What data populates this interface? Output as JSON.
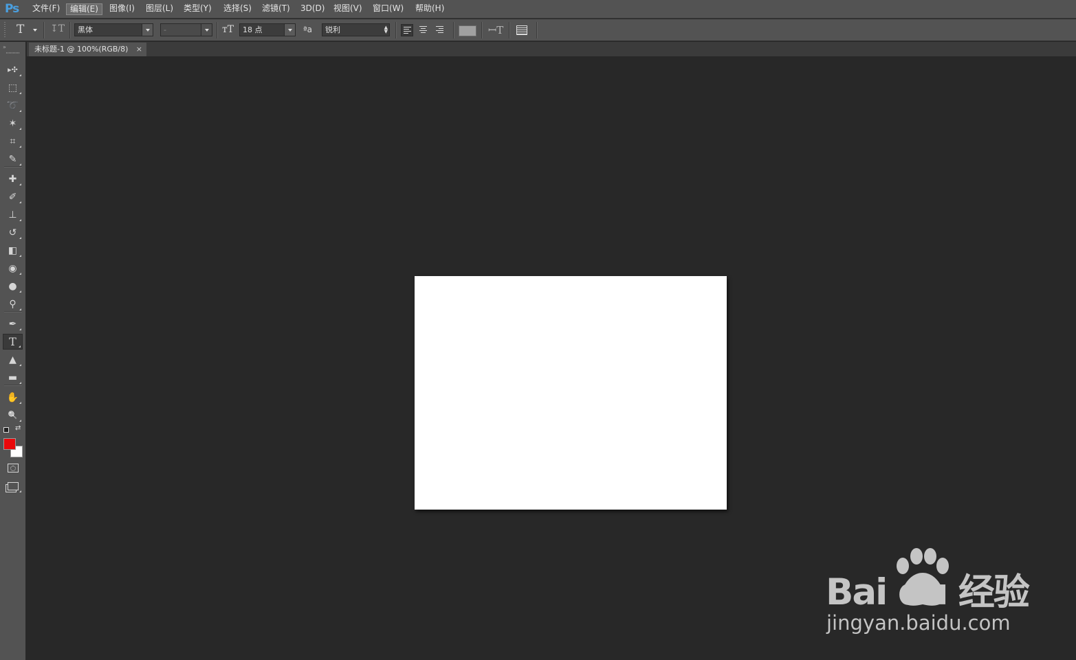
{
  "app": {
    "logo": "Ps"
  },
  "menu": [
    {
      "label": "文件(F)"
    },
    {
      "label": "编辑(E)",
      "active": true
    },
    {
      "label": "图像(I)"
    },
    {
      "label": "图层(L)"
    },
    {
      "label": "类型(Y)"
    },
    {
      "label": "选择(S)"
    },
    {
      "label": "滤镜(T)"
    },
    {
      "label": "3D(D)"
    },
    {
      "label": "视图(V)"
    },
    {
      "label": "窗口(W)"
    },
    {
      "label": "帮助(H)"
    }
  ],
  "options": {
    "tool_glyph": "T",
    "font_family": "黑体",
    "font_style": "-",
    "font_size": "18 点",
    "aa_label": "ªa",
    "antialias": "锐利",
    "text_color": "#a0a0a0"
  },
  "tools": [
    {
      "name": "move-tool",
      "glyph": "▸✣"
    },
    {
      "name": "rectangular-marquee-tool",
      "glyph": "⬚"
    },
    {
      "name": "lasso-tool",
      "glyph": "➰"
    },
    {
      "name": "magic-wand-tool",
      "glyph": "✶"
    },
    {
      "name": "crop-tool",
      "glyph": "⌗"
    },
    {
      "name": "eyedropper-tool",
      "glyph": "✎"
    },
    {
      "name": "healing-brush-tool",
      "glyph": "✚"
    },
    {
      "name": "brush-tool",
      "glyph": "✐"
    },
    {
      "name": "clone-stamp-tool",
      "glyph": "⊥"
    },
    {
      "name": "history-brush-tool",
      "glyph": "↺"
    },
    {
      "name": "eraser-tool",
      "glyph": "◧"
    },
    {
      "name": "paint-bucket-tool",
      "glyph": "◉"
    },
    {
      "name": "blur-tool",
      "glyph": "●"
    },
    {
      "name": "dodge-tool",
      "glyph": "⚲"
    },
    {
      "name": "pen-tool",
      "glyph": "✒"
    },
    {
      "name": "type-tool",
      "glyph": "T",
      "selected": true
    },
    {
      "name": "path-selection-tool",
      "glyph": "▲"
    },
    {
      "name": "rectangle-tool",
      "glyph": "▬"
    },
    {
      "name": "hand-tool",
      "glyph": "✋"
    },
    {
      "name": "zoom-tool",
      "glyph": "🔍"
    }
  ],
  "colors": {
    "foreground": "#e8090b",
    "background": "#ffffff",
    "canvas_bg": "#282828"
  },
  "document": {
    "tab_title": "未标题-1 @ 100%(RGB/8)",
    "close": "×"
  },
  "watermark": {
    "brand": "Bai du 经验",
    "url": "jingyan.baidu.com"
  }
}
